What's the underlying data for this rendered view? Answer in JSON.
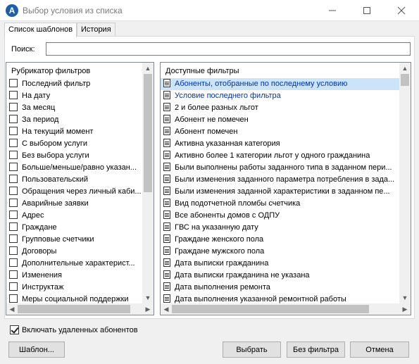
{
  "window": {
    "app_icon_glyph": "A",
    "title": "Выбор условия из списка"
  },
  "tabs": [
    {
      "label": "Список шаблонов",
      "active": true
    },
    {
      "label": "История",
      "active": false
    }
  ],
  "search": {
    "label": "Поиск:",
    "value": ""
  },
  "rubricator": {
    "header": "Рубрикатор фильтров",
    "items": [
      "Последний фильтр",
      "На дату",
      "За месяц",
      "За период",
      "На текущий момент",
      "С выбором услуги",
      "Без выбора услуги",
      "Больше/меньше/равно указан...",
      "Пользовательский",
      "Обращения через личный каби...",
      "Аварийные заявки",
      "Адрес",
      "Граждане",
      "Групповые счетчики",
      "Договоры",
      "Дополнительные характерист...",
      "Изменения",
      "Инструктаж",
      "Меры социальной поддержки"
    ]
  },
  "filters": {
    "header": "Доступные фильтры",
    "selected_index": 0,
    "items": [
      "Абоненты, отобранные по последнему условию",
      "Условие последнего фильтра",
      "2 и более разных льгот",
      "Абонент не помечен",
      "Абонент помечен",
      "Активна указанная категория",
      "Активно более 1 категории льгот у одного гражданина",
      "Были выполнены работы заданного типа в заданном пери...",
      "Были изменения заданного параметра потребления в задa...",
      "Были изменения заданной характеристики в заданном пе...",
      "Вид подотчетной пломбы счетчика",
      "Все абоненты домов с ОДПУ",
      "ГВС на указанную дату",
      "Граждане женского пола",
      "Граждане мужского пола",
      "Дата выписки гражданина",
      "Дата выписки гражданина не указана",
      "Дата выполнения ремонта",
      "Дата выполнения указанной ремонтной работы"
    ]
  },
  "include_deleted": {
    "label": "Включать удаленных абонентов",
    "checked": true
  },
  "buttons": {
    "template": "Шаблон...",
    "select": "Выбрать",
    "no_filter": "Без фильтра",
    "cancel": "Отмена"
  },
  "colors": {
    "selection": "#cce4f7",
    "link": "#0033aa",
    "app_icon": "#1f5fa8"
  }
}
